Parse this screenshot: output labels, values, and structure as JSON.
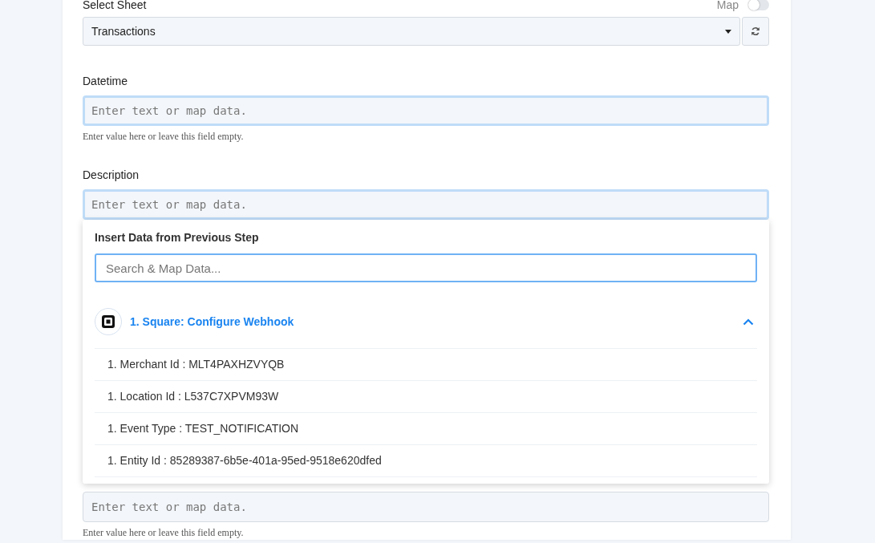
{
  "sheet_select": {
    "label": "Select Sheet",
    "value": "Transactions",
    "map_toggle": {
      "label": "Map",
      "on": false
    }
  },
  "fields": [
    {
      "label": "Datetime",
      "placeholder": "Enter text or map data.",
      "hint": "Enter value here or leave this field empty.",
      "focused": true
    },
    {
      "label": "Description",
      "placeholder": "Enter text or map data.",
      "focused": true,
      "dropdown": {
        "title": "Insert Data from Previous Step",
        "search_placeholder": "Search & Map Data...",
        "step": {
          "title": "1. Square: Configure Webhook",
          "expanded": true,
          "items": [
            "1. Merchant Id : MLT4PAXHZVYQB",
            "1. Location Id : L537C7XPVM93W",
            "1. Event Type : TEST_NOTIFICATION",
            "1. Entity Id : 85289387-6b5e-401a-95ed-9518e620dfed"
          ]
        }
      }
    },
    {
      "placeholder": "Enter text or map data.",
      "hint": "Enter value here or leave this field empty.",
      "focused": false
    }
  ]
}
